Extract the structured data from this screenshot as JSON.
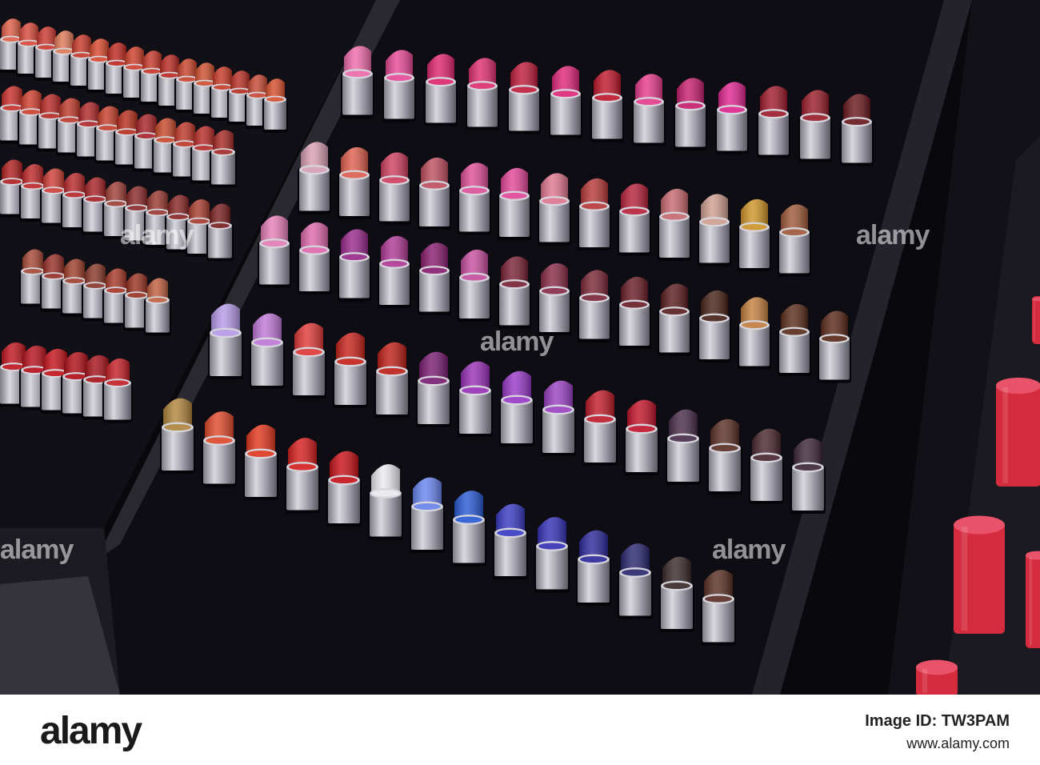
{
  "watermark": {
    "text": "alamy"
  },
  "footer": {
    "logo": "alamy",
    "image_id": "Image ID: TW3PAM",
    "site": "www.alamy.com"
  },
  "colors": {
    "background": "#09080d",
    "tray": "#131218",
    "tube_silver": "#b9b7c0",
    "footer_bg": "#ffffff"
  },
  "lipstick_rows": [
    {
      "shades": [
        "#b0863e",
        "#e04a2c",
        "#e2381f",
        "#d5201e",
        "#c8141a",
        "#ececf1",
        "#6a86f0",
        "#2a5ad4",
        "#3a3cc4",
        "#3532b8",
        "#2d2a9c",
        "#2b2870",
        "#3a2a2a",
        "#5a3024"
      ]
    },
    {
      "shades": [
        "#b89be8",
        "#c079d8",
        "#e03b38",
        "#c8241c",
        "#bf2018",
        "#7a1e72",
        "#9a32b8",
        "#9a3ac8",
        "#9c42c4",
        "#c11d2a",
        "#c3162c",
        "#4a2e4a",
        "#5b3126",
        "#4a2830",
        "#3e2838"
      ]
    },
    {
      "shades": [
        "#e680b8",
        "#e06aae",
        "#9a2a8c",
        "#b03a96",
        "#8a1e70",
        "#c850a0",
        "#7a2436",
        "#8a2c48",
        "#7c2838",
        "#6a1e28",
        "#5b1e1e",
        "#4a2418",
        "#c48040",
        "#5a2e1c",
        "#5a2a1a"
      ]
    },
    {
      "shades": [
        "#d9a0b4",
        "#e06050",
        "#d04060",
        "#c05060",
        "#e0509a",
        "#e4489a",
        "#e07890",
        "#b83a3a",
        "#b8243c",
        "#c86a70",
        "#d0a090",
        "#d0962a",
        "#a05a3a"
      ]
    },
    {
      "shades": [
        "#f06cac",
        "#e84a98",
        "#e0286e",
        "#e0306e",
        "#c01e3c",
        "#e0287a",
        "#c0182c",
        "#e83c8e",
        "#c82070",
        "#e02890",
        "#a01c2c",
        "#9a1e2a",
        "#6a1a1e"
      ]
    }
  ],
  "left_rows": [
    {
      "shades": [
        "#e0604a",
        "#d84a3a",
        "#cc3a30",
        "#e07a58",
        "#c83a2a",
        "#d84a30",
        "#c02a20",
        "#d0402c",
        "#c8382a",
        "#b82a22",
        "#c8442c",
        "#d05030",
        "#c83c28",
        "#b83024",
        "#c84a36",
        "#d8502e"
      ]
    },
    {
      "shades": [
        "#c8302a",
        "#d0402e",
        "#b82a26",
        "#c03a2c",
        "#b0282a",
        "#c8402c",
        "#b8301e",
        "#a8242a",
        "#c84a2c",
        "#c0382a",
        "#b82c28",
        "#a62a26"
      ]
    },
    {
      "shades": [
        "#b02020",
        "#c02a2a",
        "#d04038",
        "#b82a2c",
        "#a82428",
        "#a04038",
        "#8c2a2a",
        "#9a3a32",
        "#8a2626",
        "#a83e30",
        "#7a2020"
      ]
    },
    {
      "shades": [
        "#a84a36",
        "#983028",
        "#a0402c",
        "#8a3a2c",
        "#a83a2a",
        "#9a3424",
        "#c06040"
      ]
    },
    {
      "shades": [
        "#c01620",
        "#b8121e",
        "#c4141c",
        "#b01018",
        "#a8141c",
        "#c42028"
      ]
    }
  ]
}
